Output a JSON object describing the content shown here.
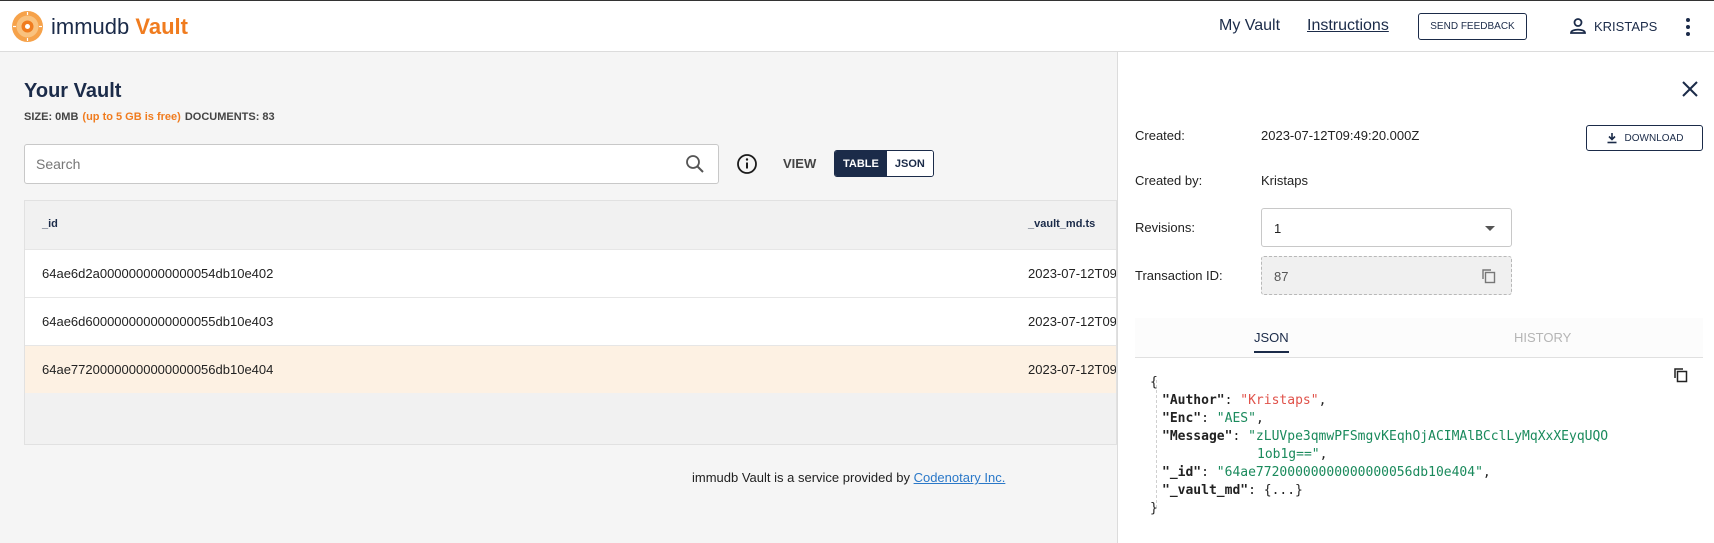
{
  "header": {
    "brand_prefix": "immudb",
    "brand_accent": "Vault",
    "nav_my_vault": "My Vault",
    "nav_instructions": "Instructions",
    "feedback_label": "SEND FEEDBACK",
    "user_name": "KRISTAPS"
  },
  "main": {
    "title": "Your Vault",
    "size_label": "SIZE: 0MB",
    "free_note": "(up to 5 GB is free)",
    "documents_label": "DOCUMENTS: 83",
    "search_placeholder": "Search",
    "view_label": "VIEW",
    "view_options": [
      "TABLE",
      "JSON"
    ],
    "table": {
      "columns": [
        "_id",
        "_vault_md.ts"
      ],
      "rows": [
        {
          "id": "64ae6d2a0000000000000054db10e402",
          "ts": "2023-07-12T09:"
        },
        {
          "id": "64ae6d600000000000000055db10e403",
          "ts": "2023-07-12T09:"
        },
        {
          "id": "64ae77200000000000000056db10e404",
          "ts": "2023-07-12T09:"
        }
      ]
    },
    "footer_text": "immudb Vault is a service provided by ",
    "footer_link": "Codenotary Inc."
  },
  "panel": {
    "created_label": "Created:",
    "created_value": "2023-07-12T09:49:20.000Z",
    "download_label": "DOWNLOAD",
    "created_by_label": "Created by:",
    "created_by_value": "Kristaps",
    "revisions_label": "Revisions:",
    "revisions_value": "1",
    "tx_label": "Transaction ID:",
    "tx_value": "87",
    "tabs": [
      "JSON",
      "HISTORY"
    ],
    "json": {
      "open": "{",
      "close": "}",
      "author_key": "\"Author\"",
      "author_val": "\"Kristaps\"",
      "enc_key": "\"Enc\"",
      "enc_val": "\"AES\"",
      "message_key": "\"Message\"",
      "message_val_1": "\"zLUVpe3qmwPFSmgvKEqhOjACIMAlBCclLyMqXxXEyqUQO",
      "message_val_2": "1ob1g==\"",
      "id_key": "\"_id\"",
      "id_val": "\"64ae77200000000000000056db10e404\"",
      "md_key": "\"_vault_md\"",
      "md_val": "{...}"
    }
  },
  "colors": {
    "brand_navy": "#1b2b49",
    "brand_orange": "#f07c1f",
    "selected_row": "#fdf1e3",
    "json_red": "#e0524a",
    "json_green": "#1a8a5c"
  }
}
